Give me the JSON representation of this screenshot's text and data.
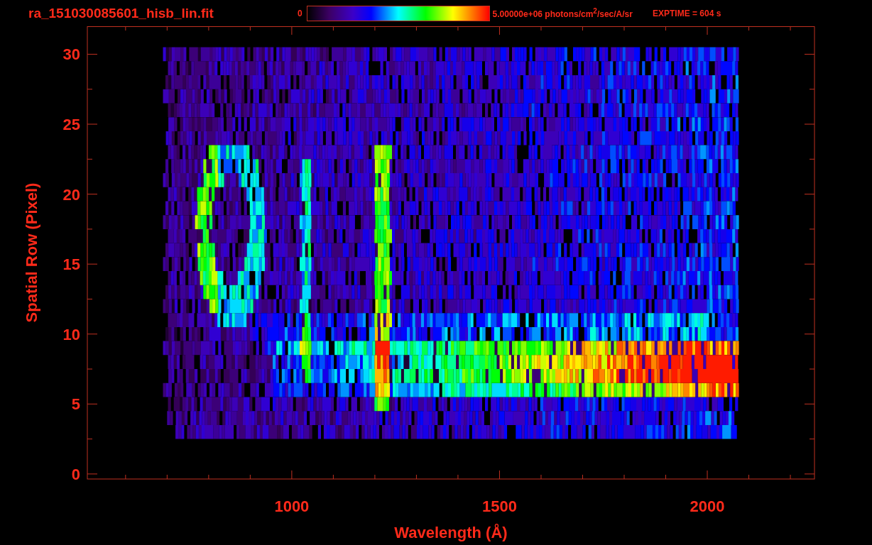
{
  "title": "ra_151030085601_hisb_lin.fit",
  "colorbar": {
    "min_label": "0",
    "max_label": "5.00000e+06 photons/cm$^{2}$/sec/A/sr"
  },
  "exposure": "EXPTIME = 604 s",
  "plot": {
    "xlabel": "Wavelength (Å)",
    "ylabel": "Spatial Row (Pixel)",
    "xticks": [
      "1000",
      "1500",
      "2000"
    ],
    "yticks": [
      "30",
      "25",
      "20",
      "15",
      "10",
      "5",
      "0"
    ]
  }
}
